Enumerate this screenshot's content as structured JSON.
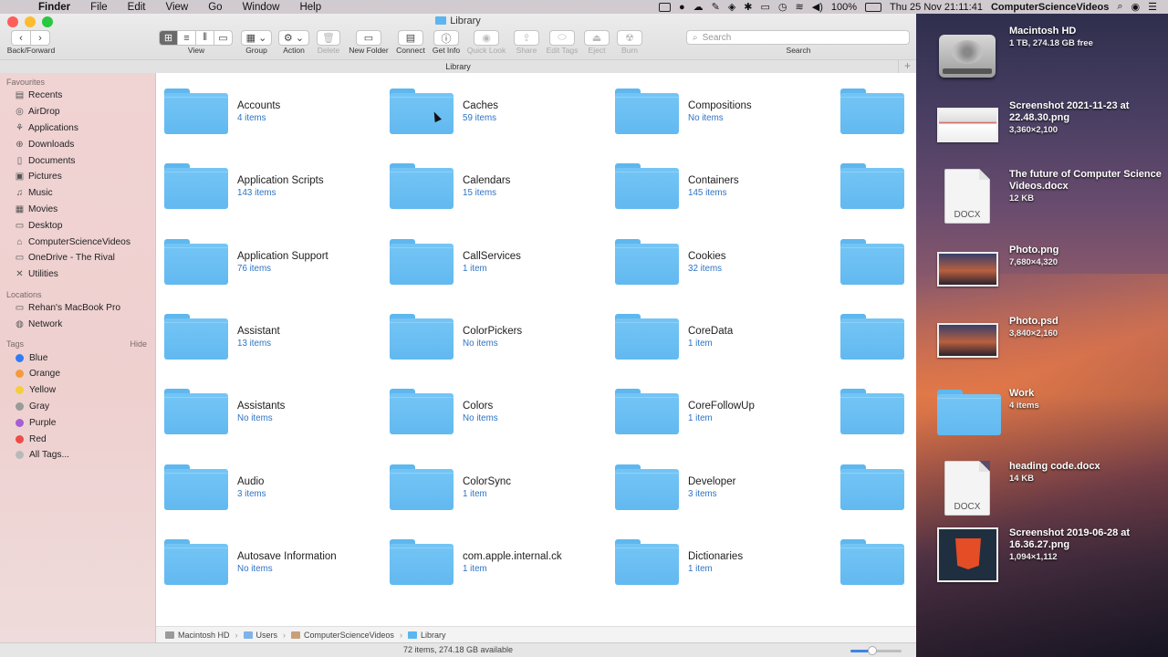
{
  "menubar": {
    "app_name": "Finder",
    "items": [
      "File",
      "Edit",
      "View",
      "Go",
      "Window",
      "Help"
    ],
    "battery": "100%",
    "datetime": "Thu 25 Nov  21:11:41",
    "user": "ComputerScienceVideos"
  },
  "window": {
    "title": "Library",
    "path_title": "Library",
    "toolbar": {
      "back_forward": "Back/Forward",
      "view": "View",
      "group": "Group",
      "action": "Action",
      "delete": "Delete",
      "new_folder": "New Folder",
      "connect": "Connect",
      "get_info": "Get Info",
      "quick_look": "Quick Look",
      "share": "Share",
      "edit_tags": "Edit Tags",
      "eject": "Eject",
      "burn": "Burn",
      "search_placeholder": "Search",
      "search_label": "Search"
    }
  },
  "sidebar": {
    "favourites_header": "Favourites",
    "favourites": [
      {
        "label": "Recents",
        "icon": "recents-icon"
      },
      {
        "label": "AirDrop",
        "icon": "airdrop-icon"
      },
      {
        "label": "Applications",
        "icon": "applications-icon"
      },
      {
        "label": "Downloads",
        "icon": "downloads-icon"
      },
      {
        "label": "Documents",
        "icon": "documents-icon"
      },
      {
        "label": "Pictures",
        "icon": "pictures-icon"
      },
      {
        "label": "Music",
        "icon": "music-icon"
      },
      {
        "label": "Movies",
        "icon": "movies-icon"
      },
      {
        "label": "Desktop",
        "icon": "desktop-icon"
      },
      {
        "label": "ComputerScienceVideos",
        "icon": "home-icon"
      },
      {
        "label": "OneDrive - The Rival",
        "icon": "folder-icon"
      },
      {
        "label": "Utilities",
        "icon": "utilities-icon"
      }
    ],
    "locations_header": "Locations",
    "locations": [
      {
        "label": "Rehan's MacBook Pro",
        "icon": "laptop-icon"
      },
      {
        "label": "Network",
        "icon": "network-icon"
      }
    ],
    "tags_header": "Tags",
    "tags_hide": "Hide",
    "tags": [
      {
        "label": "Blue",
        "color": "#2f7cf6"
      },
      {
        "label": "Orange",
        "color": "#f39a3c"
      },
      {
        "label": "Yellow",
        "color": "#f5cd3a"
      },
      {
        "label": "Gray",
        "color": "#9a9a9a"
      },
      {
        "label": "Purple",
        "color": "#a55ed6"
      },
      {
        "label": "Red",
        "color": "#ee4b48"
      },
      {
        "label": "All Tags...",
        "color": "#b9b9b9"
      }
    ]
  },
  "folders": [
    [
      {
        "name": "Accounts",
        "count": "4 items"
      },
      {
        "name": "Application Scripts",
        "count": "143 items"
      },
      {
        "name": "Application Support",
        "count": "76 items"
      },
      {
        "name": "Assistant",
        "count": "13 items"
      },
      {
        "name": "Assistants",
        "count": "No items"
      },
      {
        "name": "Audio",
        "count": "3 items"
      },
      {
        "name": "Autosave Information",
        "count": "No items"
      }
    ],
    [
      {
        "name": "Caches",
        "count": "59 items"
      },
      {
        "name": "Calendars",
        "count": "15 items"
      },
      {
        "name": "CallServices",
        "count": "1 item"
      },
      {
        "name": "ColorPickers",
        "count": "No items"
      },
      {
        "name": "Colors",
        "count": "No items"
      },
      {
        "name": "ColorSync",
        "count": "1 item"
      },
      {
        "name": "com.apple.internal.ck",
        "count": "1 item"
      }
    ],
    [
      {
        "name": "Compositions",
        "count": "No items"
      },
      {
        "name": "Containers",
        "count": "145 items"
      },
      {
        "name": "Cookies",
        "count": "32 items"
      },
      {
        "name": "CoreData",
        "count": "1 item"
      },
      {
        "name": "CoreFollowUp",
        "count": "1 item"
      },
      {
        "name": "Developer",
        "count": "3 items"
      },
      {
        "name": "Dictionaries",
        "count": "1 item"
      }
    ]
  ],
  "pathbar": [
    "Macintosh HD",
    "Users",
    "ComputerScienceVideos",
    "Library"
  ],
  "status": "72 items, 274.18 GB available",
  "desktop": [
    {
      "name": "Macintosh HD",
      "sub": "1 TB, 274.18 GB free",
      "kind": "disk"
    },
    {
      "name": "Screenshot 2021-11-23 at 22.48.30.png",
      "sub": "3,360×2,100",
      "kind": "screenshot"
    },
    {
      "name": "The future of Computer Science Videos.docx",
      "sub": "12 KB",
      "kind": "docx",
      "badge": "DOCX"
    },
    {
      "name": "Photo.png",
      "sub": "7,680×4,320",
      "kind": "photo"
    },
    {
      "name": "Photo.psd",
      "sub": "3,840×2,160",
      "kind": "photo"
    },
    {
      "name": "Work",
      "sub": "4 items",
      "kind": "folder"
    },
    {
      "name": "heading code.docx",
      "sub": "14 KB",
      "kind": "docx",
      "badge": "DOCX"
    },
    {
      "name": "Screenshot 2019-06-28 at 16.36.27.png",
      "sub": "1,094×1,112",
      "kind": "html5"
    }
  ]
}
